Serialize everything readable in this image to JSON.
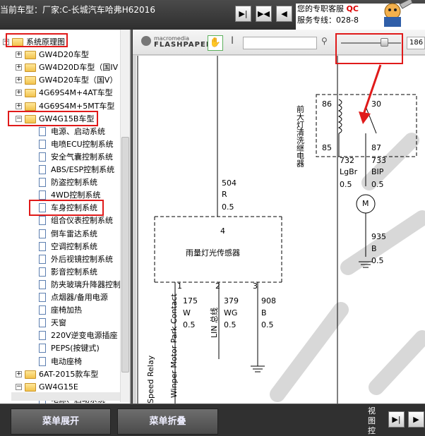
{
  "header": {
    "current_model": "当前车型：厂家:C-长城汽车哈弗H62016",
    "service": {
      "label": "您的专职客服",
      "link": "QC",
      "hotline": "服务专线：028-8"
    }
  },
  "sidebar": {
    "tree": [
      {
        "label": "系统原理图",
        "kind": "folder",
        "level": 0,
        "state": "−",
        "highlight": true
      },
      {
        "label": "GW4D20车型",
        "kind": "folder",
        "level": 1,
        "state": "+"
      },
      {
        "label": "GW4D20D车型（国IV",
        "kind": "folder",
        "level": 1,
        "state": "+"
      },
      {
        "label": "GW4D20车型（国Ⅴ）",
        "kind": "folder",
        "level": 1,
        "state": "+"
      },
      {
        "label": "4G69S4M+4AT车型",
        "kind": "folder",
        "level": 1,
        "state": "+"
      },
      {
        "label": "4G69S4M+5MT车型",
        "kind": "folder",
        "level": 1,
        "state": "+"
      },
      {
        "label": "GW4G15B车型",
        "kind": "folder",
        "level": 1,
        "state": "−",
        "highlight": true
      },
      {
        "label": "电源、启动系统",
        "kind": "doc",
        "level": 2
      },
      {
        "label": "电喷ECU控制系统",
        "kind": "doc",
        "level": 2
      },
      {
        "label": "安全气囊控制系统",
        "kind": "doc",
        "level": 2
      },
      {
        "label": "ABS/ESP控制系统",
        "kind": "doc",
        "level": 2
      },
      {
        "label": "防盗控制系统",
        "kind": "doc",
        "level": 2
      },
      {
        "label": "4WD控制系统",
        "kind": "doc",
        "level": 2
      },
      {
        "label": "车身控制系统",
        "kind": "doc",
        "level": 2,
        "highlight": true
      },
      {
        "label": "组合仪表控制系统",
        "kind": "doc",
        "level": 2
      },
      {
        "label": "倒车雷达系统",
        "kind": "doc",
        "level": 2
      },
      {
        "label": "空调控制系统",
        "kind": "doc",
        "level": 2
      },
      {
        "label": "外后视镜控制系统",
        "kind": "doc",
        "level": 2
      },
      {
        "label": "影音控制系统",
        "kind": "doc",
        "level": 2
      },
      {
        "label": "防夹玻璃升降器控制",
        "kind": "doc",
        "level": 2
      },
      {
        "label": "点烟器/备用电源",
        "kind": "doc",
        "level": 2
      },
      {
        "label": "座椅加热",
        "kind": "doc",
        "level": 2
      },
      {
        "label": "天窗",
        "kind": "doc",
        "level": 2
      },
      {
        "label": "220V逆变电源插座",
        "kind": "doc",
        "level": 2
      },
      {
        "label": "PEPS(按键式)",
        "kind": "doc",
        "level": 2
      },
      {
        "label": "电动座椅",
        "kind": "doc",
        "level": 2
      },
      {
        "label": "6AT-2015款车型",
        "kind": "folder",
        "level": 1,
        "state": "+"
      },
      {
        "label": "GW4G15E",
        "kind": "folder",
        "level": 1,
        "state": "−"
      },
      {
        "label": "电源、启动系统",
        "kind": "doc",
        "level": 2
      }
    ]
  },
  "viewer": {
    "brand_top": "macromedia",
    "brand_name": "FLASHPAPER",
    "search": {
      "value": ""
    },
    "zoom": {
      "text": "186",
      "fraction": 0.72
    }
  },
  "schematic": {
    "relay_title": "前大灯清洗继电器",
    "relay_pins": [
      "86",
      "30",
      "85",
      "87"
    ],
    "wire_504": [
      "504",
      "R",
      "0.5"
    ],
    "wire_732": [
      "732",
      "LgBr",
      "0.5"
    ],
    "wire_733": [
      "733",
      "BIP",
      "0.5"
    ],
    "wire_935": [
      "935",
      "B",
      "0.5"
    ],
    "sensor_label": "雨量灯光传感器",
    "sensor_pins": [
      "4",
      "1",
      "2",
      "3"
    ],
    "wire_175": [
      "175",
      "W",
      "0.5"
    ],
    "wire_379": [
      "379",
      "WG",
      "0.5"
    ],
    "wire_908": [
      "908",
      "B",
      "0.5"
    ],
    "vert_labels": [
      "Speed Relay",
      "Winper Motor Park Contact",
      "LIN 总线"
    ]
  },
  "footer": {
    "expand_label": "菜单展开",
    "collapse_label": "菜单折叠",
    "view_control": "视图控"
  }
}
